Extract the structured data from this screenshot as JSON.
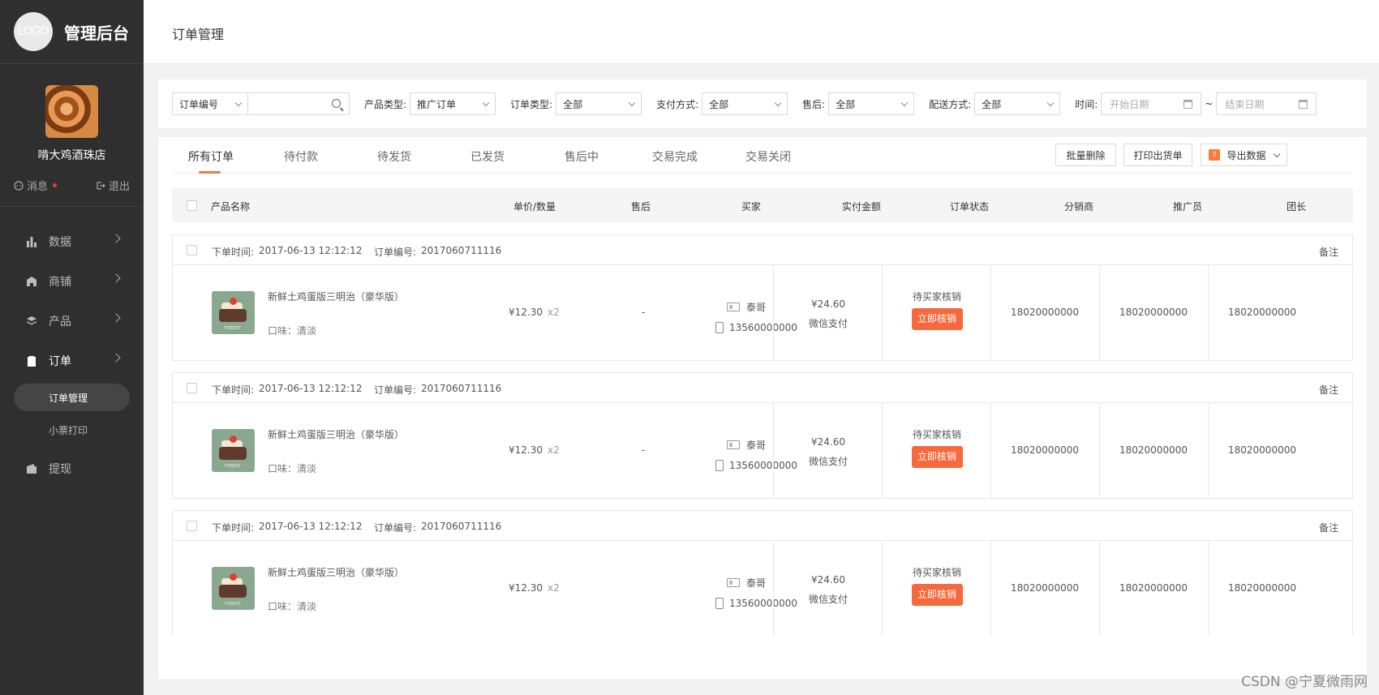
{
  "sidebar": {
    "logo_text": "LOGO",
    "title": "管理后台",
    "shop_name": "啃大鸡酒珠店",
    "messages_label": "消息",
    "logout_label": "退出",
    "nav": [
      {
        "label": "数据",
        "icon": "bar-chart-icon"
      },
      {
        "label": "商铺",
        "icon": "shop-icon"
      },
      {
        "label": "产品",
        "icon": "layers-icon"
      },
      {
        "label": "订单",
        "icon": "clipboard-icon"
      }
    ],
    "sub_items": [
      {
        "label": "订单管理",
        "active": true
      },
      {
        "label": "小票打印",
        "active": false
      }
    ],
    "withdraw_label": "提现"
  },
  "header": {
    "title": "订单管理"
  },
  "filters": {
    "search_type": "订单编号",
    "product_type_label": "产品类型:",
    "product_type_value": "推广订单",
    "order_type_label": "订单类型:",
    "order_type_value": "全部",
    "payment_label": "支付方式:",
    "payment_value": "全部",
    "aftersale_label": "售后:",
    "aftersale_value": "全部",
    "delivery_label": "配送方式:",
    "delivery_value": "全部",
    "time_label": "时间:",
    "start_placeholder": "开始日期",
    "tilde": "~",
    "end_placeholder": "结束日期"
  },
  "tabs": [
    "所有订单",
    "待付款",
    "待发货",
    "已发货",
    "售后中",
    "交易完成",
    "交易关闭"
  ],
  "actions": {
    "batch_delete": "批量删除",
    "print_invoice": "打印出货单",
    "export": "导出数据"
  },
  "table_header": {
    "product": "产品名称",
    "price_qty": "单价/数量",
    "aftersale": "售后",
    "buyer": "买家",
    "paid": "实付金额",
    "status": "订单状态",
    "distributor": "分销商",
    "promoter": "推广员",
    "leader": "团长"
  },
  "orders": [
    {
      "time_label": "下单时间:",
      "time": "2017-06-13 12:12:12",
      "no_label": "订单编号:",
      "no": "2017060711116",
      "remark": "备注",
      "product_name": "新鲜土鸡蛋版三明治（豪华版）",
      "flavor": "口味：清淡",
      "price": "¥12.30",
      "qty": "x2",
      "aftersale": "-",
      "buyer_name": "泰哥",
      "buyer_phone": "13560000000",
      "amount": "¥24.60",
      "pay_method": "微信支付",
      "status": "待买家核销",
      "action": "立即核销",
      "distributor": "18020000000",
      "promoter": "18020000000",
      "leader": "18020000000"
    },
    {
      "time_label": "下单时间:",
      "time": "2017-06-13 12:12:12",
      "no_label": "订单编号:",
      "no": "2017060711116",
      "remark": "备注",
      "product_name": "新鲜土鸡蛋版三明治（豪华版）",
      "flavor": "口味：清淡",
      "price": "¥12.30",
      "qty": "x2",
      "aftersale": "-",
      "buyer_name": "泰哥",
      "buyer_phone": "13560000000",
      "amount": "¥24.60",
      "pay_method": "微信支付",
      "status": "待买家核销",
      "action": "立即核销",
      "distributor": "18020000000",
      "promoter": "18020000000",
      "leader": "18020000000"
    },
    {
      "time_label": "下单时间:",
      "time": "2017-06-13 12:12:12",
      "no_label": "订单编号:",
      "no": "2017060711116",
      "remark": "备注",
      "product_name": "新鲜土鸡蛋版三明治（豪华版）",
      "flavor": "口味：清淡",
      "price": "¥12.30",
      "qty": "x2",
      "aftersale": "",
      "buyer_name": "泰哥",
      "buyer_phone": "13560000000",
      "amount": "¥24.60",
      "pay_method": "微信支付",
      "status": "待买家核销",
      "action": "立即核销",
      "distributor": "18020000000",
      "promoter": "18020000000",
      "leader": "18020000000"
    }
  ],
  "watermark": "CSDN @宁夏微雨网",
  "colors": {
    "accent": "#f5693c",
    "sidebar_bg": "#2f2f2f"
  }
}
